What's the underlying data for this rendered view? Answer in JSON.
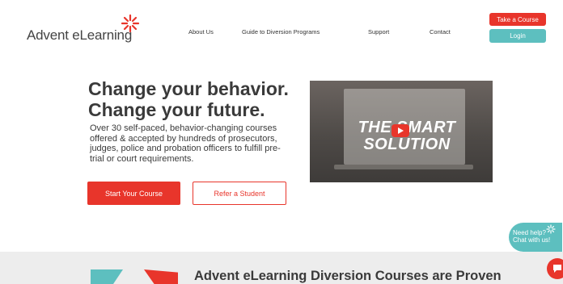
{
  "header": {
    "logo_text": "Advent eLearning",
    "nav": {
      "about": "About Us",
      "guide": "Guide to Diversion Programs",
      "support": "Support",
      "contact": "Contact"
    },
    "take_course": "Take a Course",
    "login": "Login"
  },
  "hero": {
    "title_line1": "Change your behavior.",
    "title_line2": "Change your future.",
    "body": "Over 30 self-paced, behavior-changing courses offered & accepted by hundreds of prosecutors, judges, police and probation officers to fulfill pre-trial or court requirements.",
    "start_button": "Start Your Course",
    "refer_button": "Refer a Student"
  },
  "video": {
    "overlay_line1": "THE SMART",
    "overlay_line2": "SOLUTION"
  },
  "bottom": {
    "heading": "Advent eLearning Diversion Courses are Proven"
  },
  "chat": {
    "line1": "Need help?",
    "line2": "Chat with us!"
  },
  "colors": {
    "brand_red": "#e8352b",
    "brand_teal": "#5dbfbf",
    "text_dark": "#3a3a3a"
  },
  "icons": {
    "logo_mark": "sunburst-icon",
    "play": "play-icon",
    "chat": "chat-icon"
  }
}
